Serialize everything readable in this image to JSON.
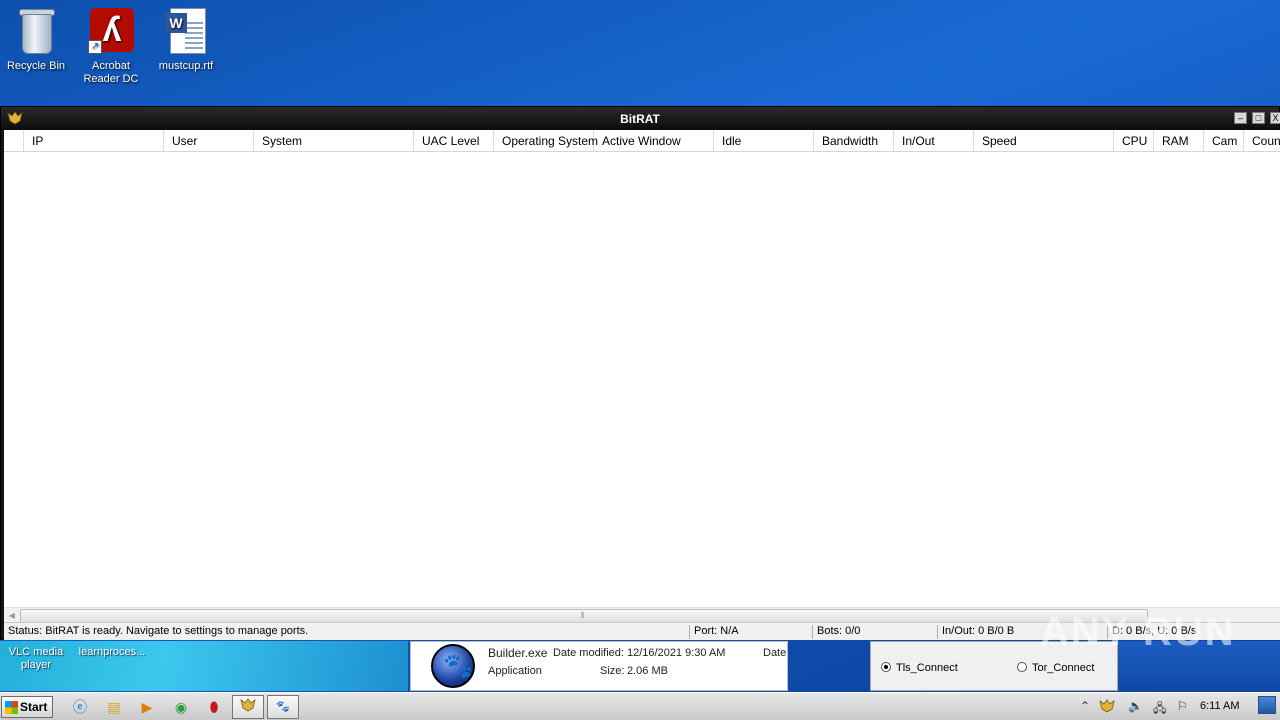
{
  "desktop": {
    "icons": [
      {
        "label": "Recycle Bin",
        "icon": "recycle-bin-icon"
      },
      {
        "label": "Acrobat Reader DC",
        "icon": "acrobat-reader-icon"
      },
      {
        "label": "mustcup.rtf",
        "icon": "word-document-icon"
      }
    ],
    "bottom_left": [
      {
        "label": "VLC media player"
      },
      {
        "label": "learnproces..."
      }
    ]
  },
  "window": {
    "title": "BitRAT",
    "controls": {
      "minimize": "–",
      "maximize": "□",
      "close": "X"
    },
    "columns": [
      "IP",
      "User",
      "System",
      "UAC Level",
      "Operating System",
      "Active Window",
      "Idle",
      "Bandwidth",
      "In/Out",
      "Speed",
      "CPU",
      "RAM",
      "Cam",
      "Count"
    ],
    "rows": [],
    "statusbar": {
      "status": "Status: BitRAT is ready. Navigate to settings to manage ports.",
      "port": "Port: N/A",
      "bots": "Bots: 0/0",
      "inout": "In/Out: 0 B/0 B",
      "speed": "D: 0 B/s, U: 0 B/s"
    }
  },
  "explorer_pane": {
    "filename": "Builder.exe",
    "date_label": "Date modified:",
    "date_value": "12/16/2021 9:30 AM",
    "date_col": "Date",
    "type": "Application",
    "size_label": "Size:",
    "size_value": "2.06 MB"
  },
  "radios": [
    {
      "label": "Tls_Connect",
      "checked": true
    },
    {
      "label": "Tor_Connect",
      "checked": false
    }
  ],
  "watermark": "ANY RUN",
  "taskbar": {
    "start_label": "Start",
    "clock": "6:11 AM"
  }
}
